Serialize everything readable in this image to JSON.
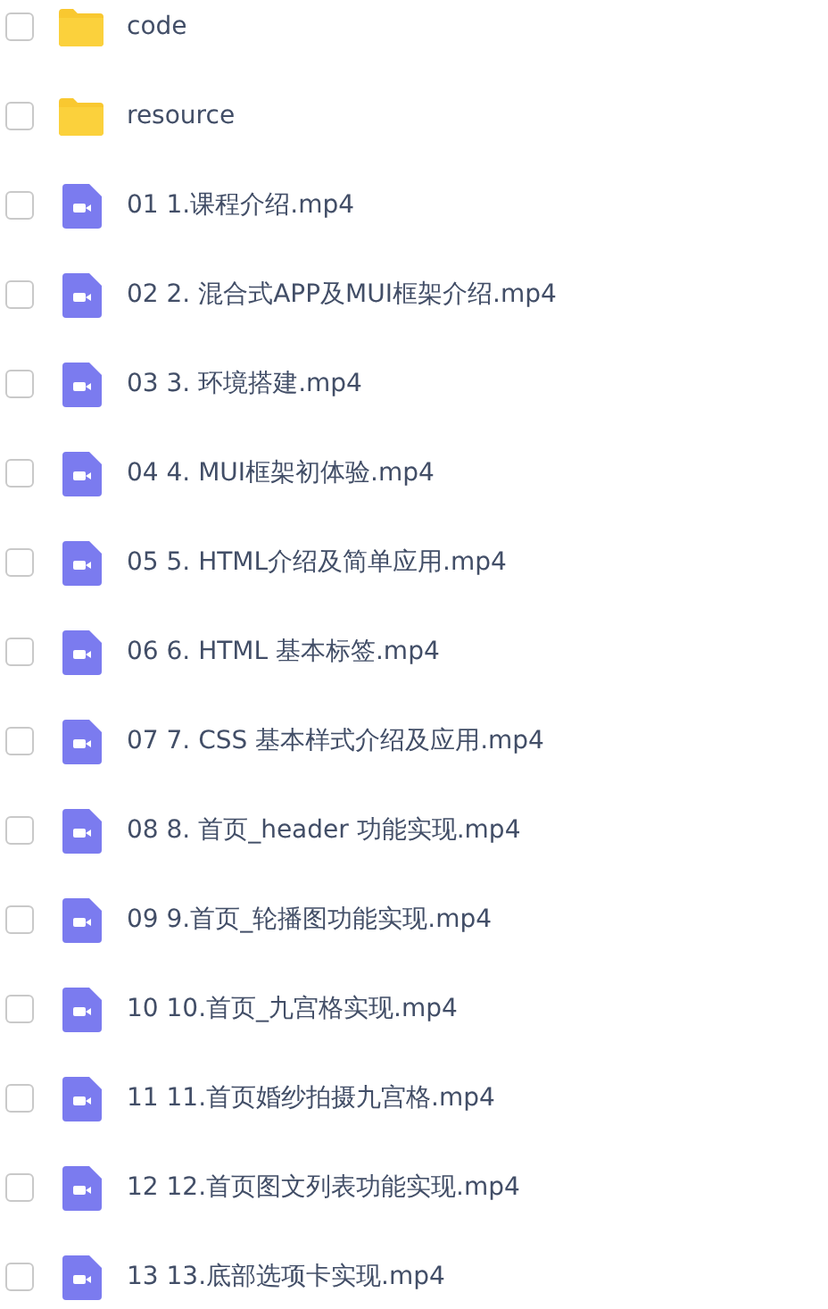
{
  "files": [
    {
      "kind": "folder",
      "name": "code",
      "checked": false
    },
    {
      "kind": "folder",
      "name": "resource",
      "checked": false
    },
    {
      "kind": "video",
      "name": "01 1.课程介绍.mp4",
      "checked": false
    },
    {
      "kind": "video",
      "name": "02 2. 混合式APP及MUI框架介绍.mp4",
      "checked": false
    },
    {
      "kind": "video",
      "name": "03 3. 环境搭建.mp4",
      "checked": false
    },
    {
      "kind": "video",
      "name": "04 4. MUI框架初体验.mp4",
      "checked": false
    },
    {
      "kind": "video",
      "name": "05 5. HTML介绍及简单应用.mp4",
      "checked": false
    },
    {
      "kind": "video",
      "name": "06 6. HTML 基本标签.mp4",
      "checked": false
    },
    {
      "kind": "video",
      "name": "07 7. CSS 基本样式介绍及应用.mp4",
      "checked": false
    },
    {
      "kind": "video",
      "name": "08 8. 首页_header 功能实现.mp4",
      "checked": false
    },
    {
      "kind": "video",
      "name": "09 9.首页_轮播图功能实现.mp4",
      "checked": false
    },
    {
      "kind": "video",
      "name": "10 10.首页_九宫格实现.mp4",
      "checked": false
    },
    {
      "kind": "video",
      "name": "11 11.首页婚纱拍摄九宫格.mp4",
      "checked": false
    },
    {
      "kind": "video",
      "name": "12 12.首页图文列表功能实现.mp4",
      "checked": false
    },
    {
      "kind": "video",
      "name": "13 13.底部选项卡实现.mp4",
      "checked": false
    }
  ]
}
